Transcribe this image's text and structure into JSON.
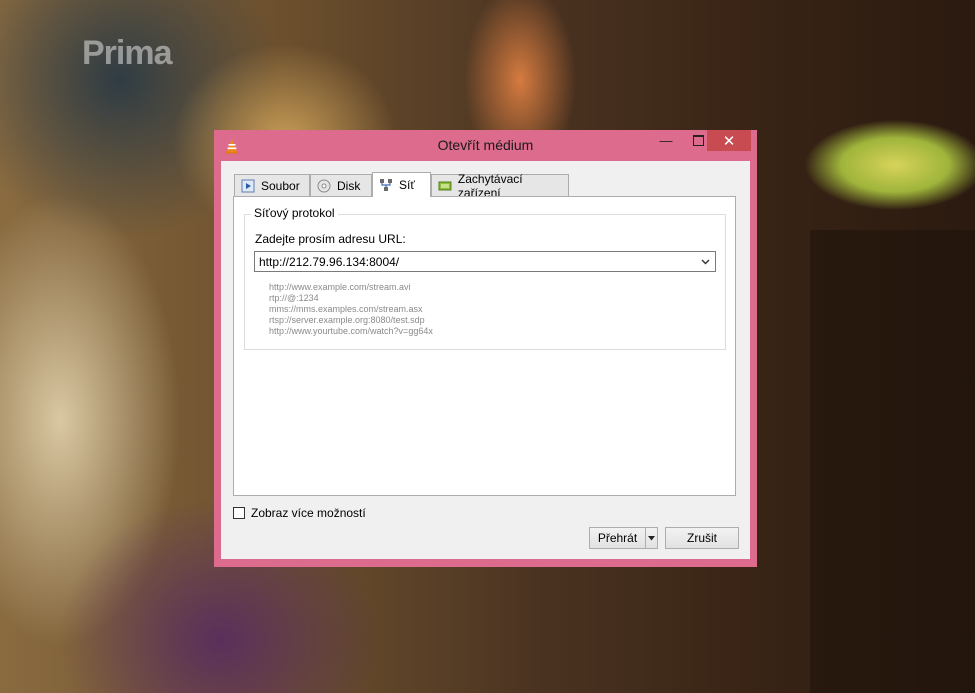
{
  "background": {
    "watermark": "Prima"
  },
  "dialog": {
    "title": "Otevřít médium",
    "app_icon": "vlc-cone-icon",
    "window_controls": {
      "minimize": "minimize-icon",
      "maximize": "maximize-icon",
      "close": "close-icon"
    },
    "tabs": [
      {
        "label": "Soubor",
        "icon": "file-play-icon",
        "active": false
      },
      {
        "label": "Disk",
        "icon": "disc-icon",
        "active": false
      },
      {
        "label": "Síť",
        "icon": "network-icon",
        "active": true
      },
      {
        "label": "Zachytávací zařízení",
        "icon": "capture-device-icon",
        "active": false
      }
    ],
    "network": {
      "group_title": "Síťový protokol",
      "url_label": "Zadejte prosím adresu URL:",
      "url_value": "http://212.79.96.134:8004/",
      "examples": [
        "http://www.example.com/stream.avi",
        "rtp://@:1234",
        "mms://mms.examples.com/stream.asx",
        "rtsp://server.example.org:8080/test.sdp",
        "http://www.yourtube.com/watch?v=gg64x"
      ]
    },
    "more_options_label": "Zobraz více možností",
    "more_options_checked": false,
    "buttons": {
      "play": "Přehrát",
      "cancel": "Zrušit"
    }
  },
  "colors": {
    "window_frame": "#dc6b8d",
    "close_button": "#c74b50",
    "client_bg": "#f0f0f0"
  }
}
